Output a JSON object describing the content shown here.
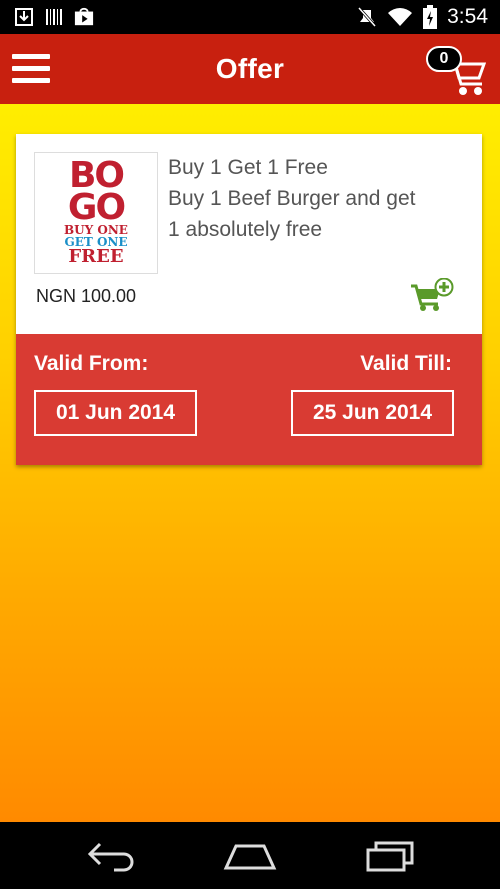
{
  "status_bar": {
    "time": "3:54",
    "icons": [
      "download-icon",
      "barcode-icon",
      "play-store-icon",
      "mute-icon",
      "wifi-icon",
      "battery-charging-icon"
    ]
  },
  "app_bar": {
    "title": "Offer",
    "cart_count": "0"
  },
  "offer": {
    "image": {
      "line1a": "BO",
      "line2a": "GO",
      "line3": "BUY ONE",
      "line4": "GET ONE",
      "line5": "FREE"
    },
    "title_lines": [
      "Buy 1 Get 1 Free",
      "Buy 1 Beef Burger and get",
      "1 absolutely free"
    ],
    "price": "NGN 100.00",
    "valid_from_label": "Valid From:",
    "valid_from": "01 Jun 2014",
    "valid_till_label": "Valid Till:",
    "valid_till": "25 Jun 2014"
  },
  "colors": {
    "app_bar": "#c8200f",
    "validity_panel": "#d93b33",
    "cart_add_icon": "#5a9a2a"
  }
}
